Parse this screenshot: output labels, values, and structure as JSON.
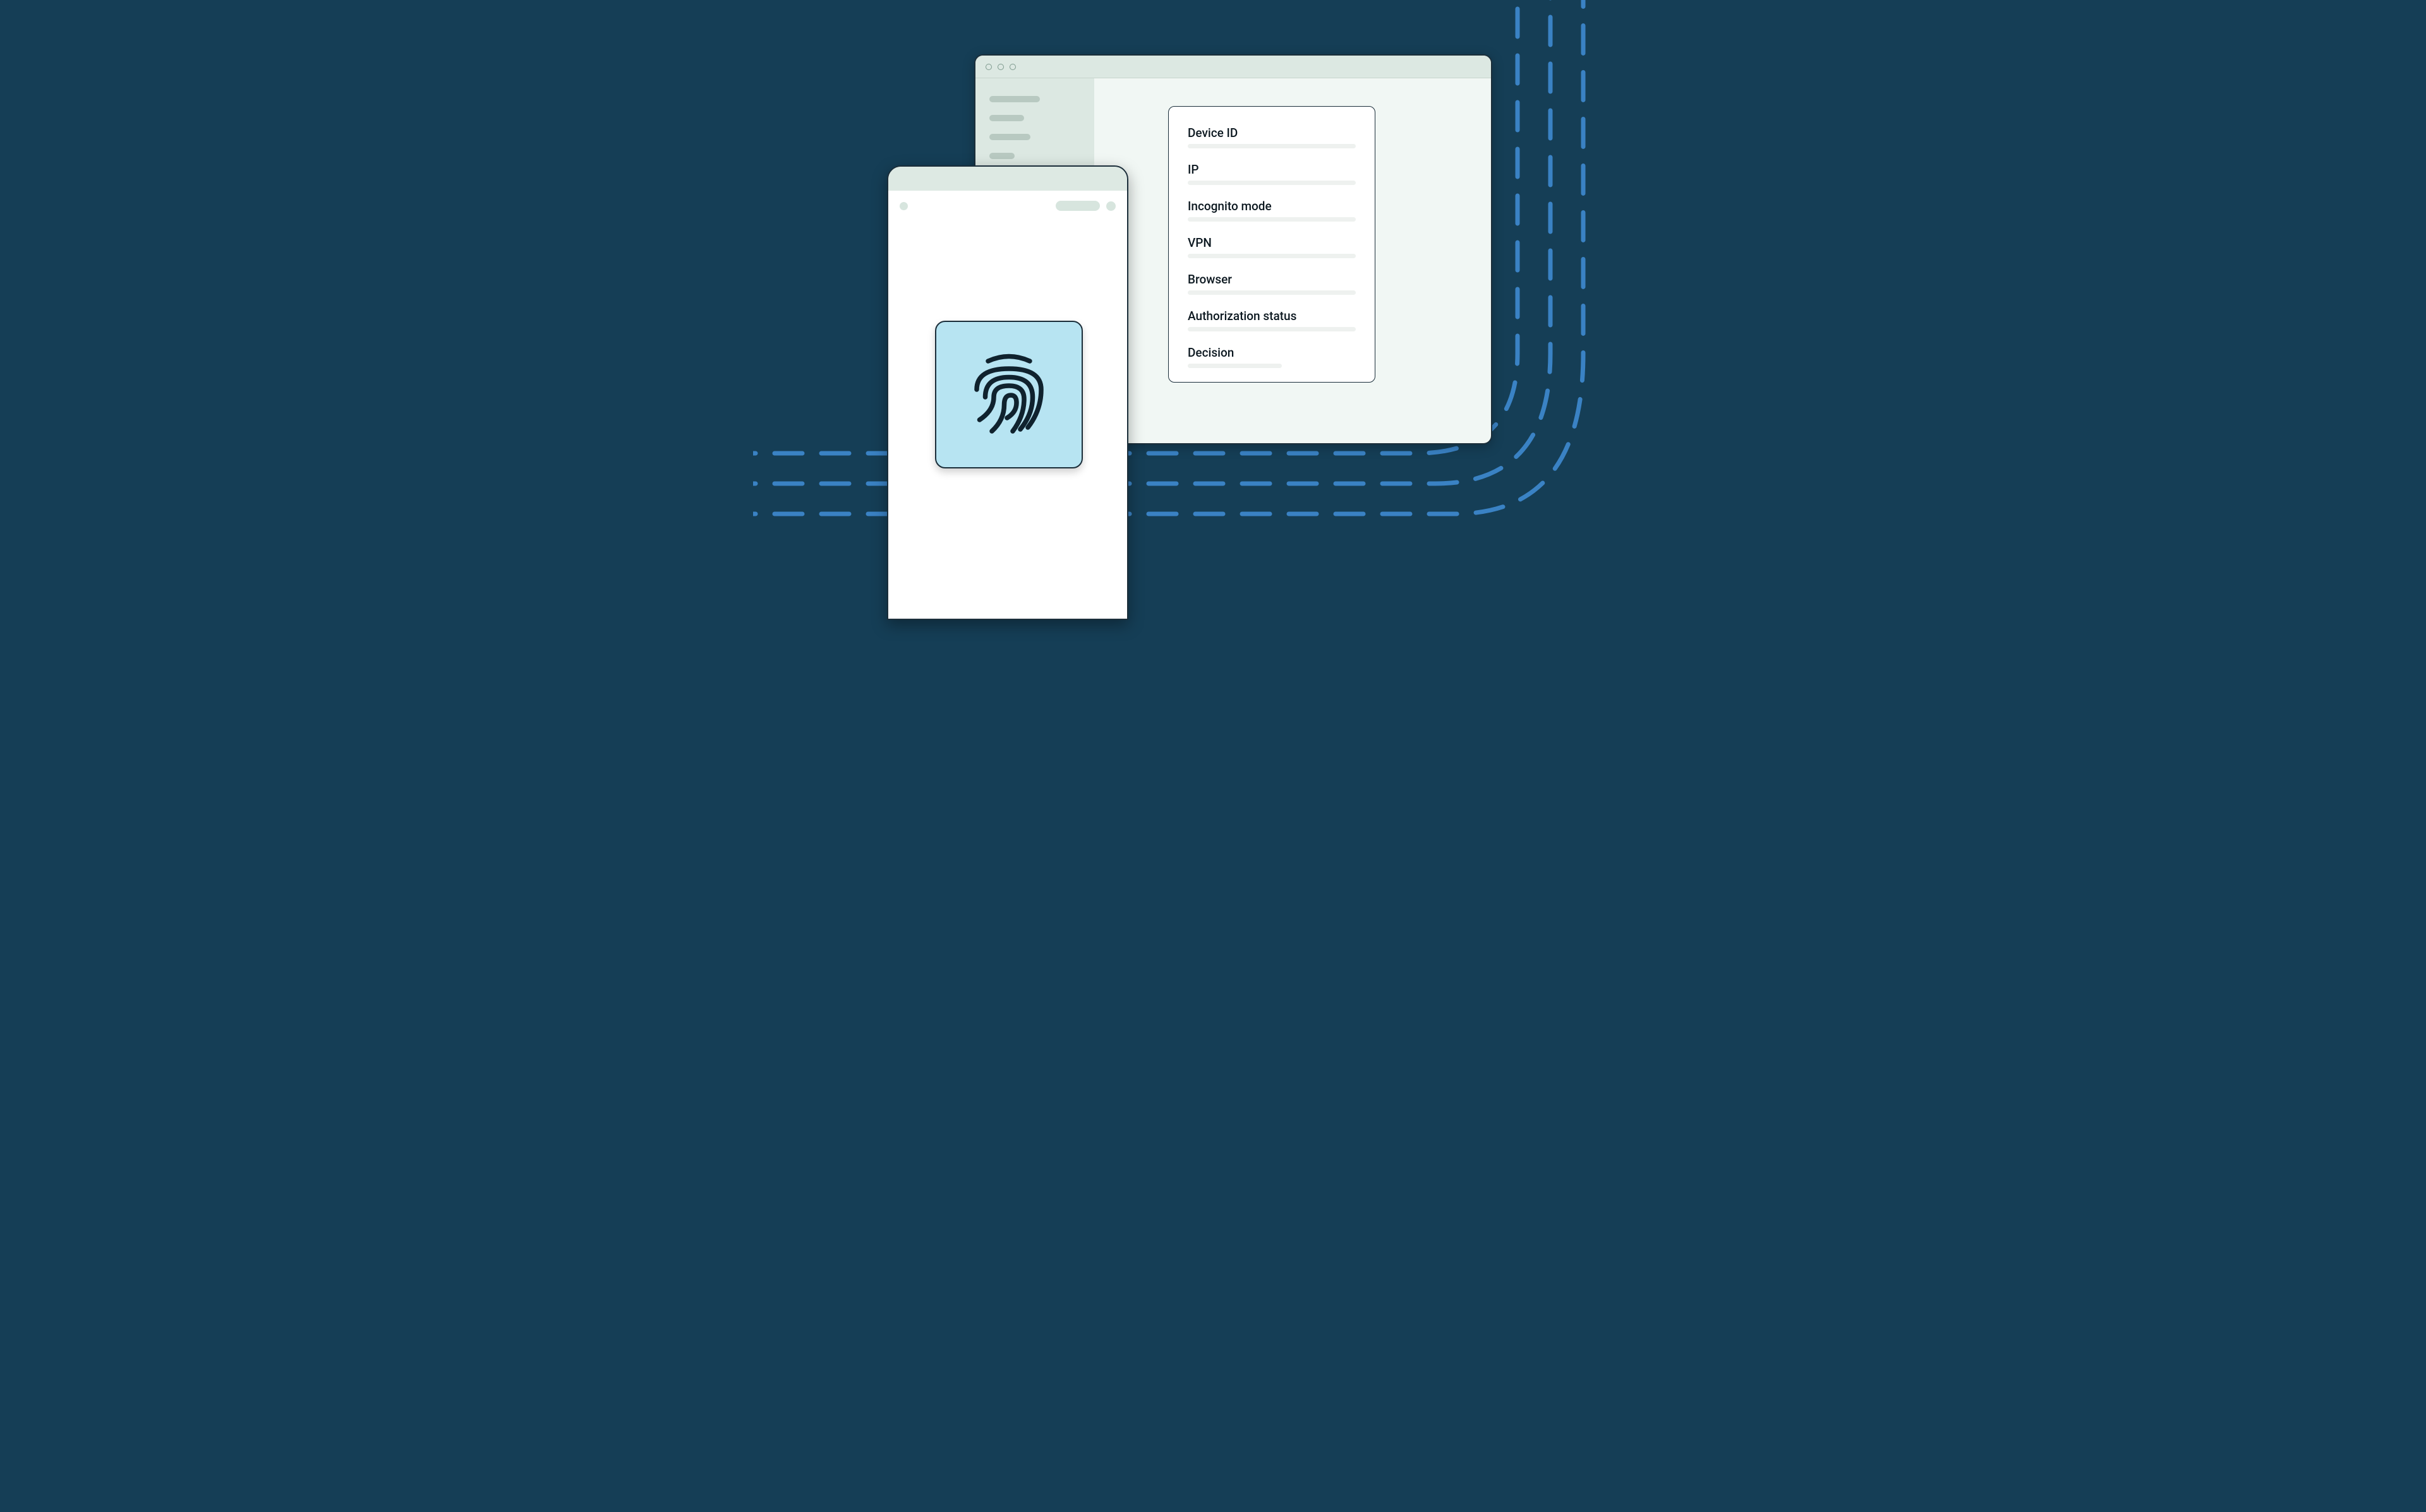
{
  "card": {
    "fields": [
      {
        "label": "Device ID"
      },
      {
        "label": "IP"
      },
      {
        "label": "Incognito mode"
      },
      {
        "label": "VPN"
      },
      {
        "label": "Browser"
      },
      {
        "label": "Authorization status"
      },
      {
        "label": "Decision"
      }
    ]
  },
  "icons": {
    "fingerprint": "fingerprint-icon"
  },
  "colors": {
    "background": "#153e56",
    "browser_body": "#f1f7f4",
    "browser_chrome": "#dce8e2",
    "tile": "#b7e4f2",
    "dash": "#3a82c4"
  }
}
